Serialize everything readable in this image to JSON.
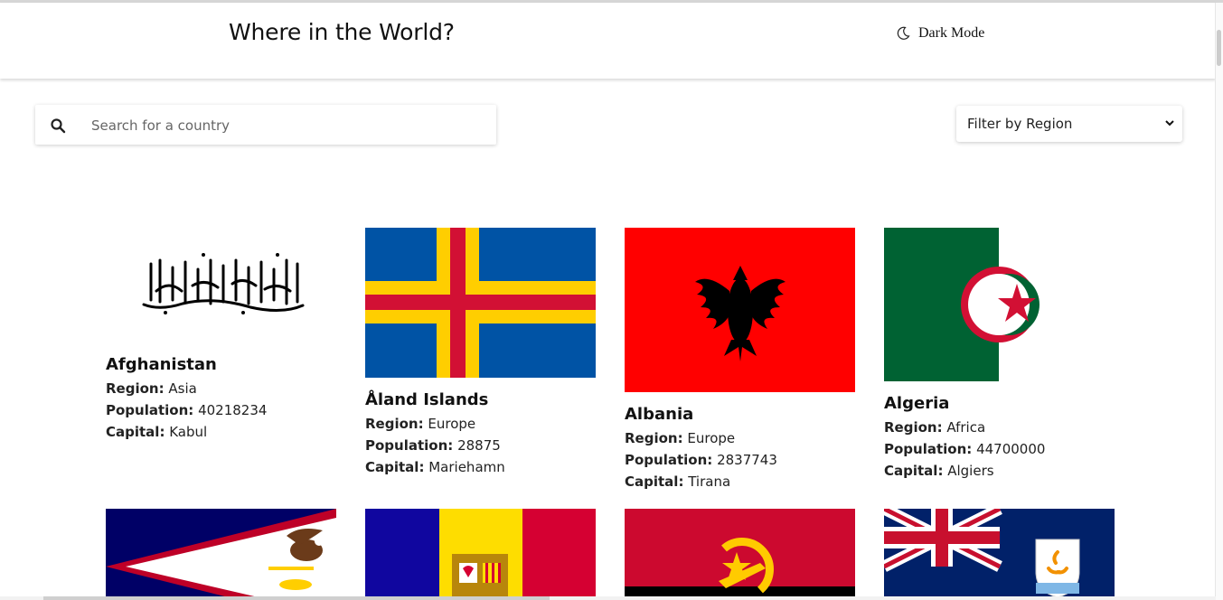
{
  "header": {
    "title": "Where in the World?",
    "mode_label": "Dark Mode",
    "mode_icon": "moon-icon"
  },
  "search": {
    "placeholder": "Search for a country",
    "value": "",
    "icon": "search-icon"
  },
  "filter": {
    "label": "Filter by Region",
    "icon": "chevron-down-icon"
  },
  "labels": {
    "region": "Region:",
    "population": "Population:",
    "capital": "Capital:"
  },
  "countries": [
    {
      "name": "Afghanistan",
      "region": "Asia",
      "population": "40218234",
      "capital": "Kabul"
    },
    {
      "name": "Åland Islands",
      "region": "Europe",
      "population": "28875",
      "capital": "Mariehamn"
    },
    {
      "name": "Albania",
      "region": "Europe",
      "population": "2837743",
      "capital": "Tirana"
    },
    {
      "name": "Algeria",
      "region": "Africa",
      "population": "44700000",
      "capital": "Algiers"
    }
  ],
  "colors": {
    "aland_blue": "#0053A5",
    "aland_yellow": "#FFCE00",
    "aland_red": "#D21034",
    "albania_red": "#FF0000",
    "algeria_green": "#006233",
    "algeria_red": "#D21034",
    "samoa_blue": "#000066",
    "samoa_red": "#BE0027",
    "andorra_blue": "#10069F",
    "andorra_yellow": "#FEDD00",
    "andorra_red": "#D50032",
    "angola_red": "#CC092F",
    "angola_yellow": "#FFCB00",
    "uk_blue": "#012169",
    "uk_red": "#C8102E"
  }
}
